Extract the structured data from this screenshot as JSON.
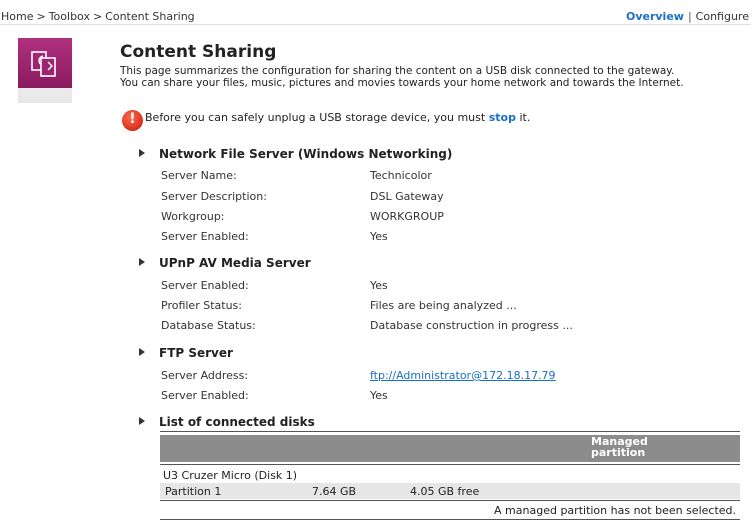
{
  "breadcrumb": {
    "items": [
      "Home",
      "Toolbox",
      "Content Sharing"
    ],
    "separator": ">"
  },
  "top_links": {
    "overview": "Overview",
    "separator": "|",
    "configure": "Configure"
  },
  "page": {
    "icon": "content-sharing-icon",
    "title": "Content Sharing",
    "description_line1": "This page summarizes the configuration for sharing the content on a USB disk connected to the gateway.",
    "description_line2": "You can share your files, music, pictures and movies towards your home network and towards the Internet."
  },
  "alert": {
    "icon": "exclamation-icon",
    "text_before": "Before you can safely unplug a USB storage device, you must ",
    "link": "stop",
    "text_after": " it."
  },
  "sections": {
    "network_file_server": {
      "title": "Network File Server (Windows Networking)",
      "rows": [
        {
          "label": "Server Name:",
          "value": "Technicolor"
        },
        {
          "label": "Server Description:",
          "value": "DSL Gateway"
        },
        {
          "label": "Workgroup:",
          "value": "WORKGROUP"
        },
        {
          "label": "Server Enabled:",
          "value": "Yes"
        }
      ]
    },
    "upnp": {
      "title": "UPnP AV Media Server",
      "rows": [
        {
          "label": "Server Enabled:",
          "value": "Yes"
        },
        {
          "label": "Profiler Status:",
          "value": "Files are being analyzed ..."
        },
        {
          "label": "Database Status:",
          "value": "Database construction in progress ..."
        }
      ]
    },
    "ftp": {
      "title": "FTP Server",
      "rows": [
        {
          "label": "Server Address:",
          "value": "ftp://Administrator@172.18.17.79"
        },
        {
          "label": "Server Enabled:",
          "value": "Yes"
        }
      ]
    },
    "disks": {
      "title": "List of connected disks",
      "header_managed": "Managed partition",
      "disk_name": "U3 Cruzer Micro (Disk 1)",
      "partition": {
        "name": "Partition 1",
        "size": "7.64 GB",
        "free": "4.05 GB free"
      },
      "note": "A managed partition has not been selected."
    }
  },
  "colors": {
    "link": "#1a6fc9",
    "icon_bg": "#9c2470",
    "alert": "#d0180c",
    "table_header": "#8c8c8c"
  }
}
